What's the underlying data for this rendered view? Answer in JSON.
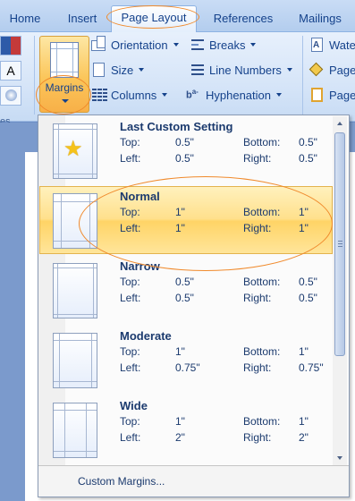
{
  "tabs": [
    "Home",
    "Insert",
    "Page Layout",
    "References",
    "Mailings"
  ],
  "active_tab": "Page Layout",
  "ribbon": {
    "margins_label": "Margins",
    "orientation_label": "Orientation",
    "size_label": "Size",
    "columns_label": "Columns",
    "breaks_label": "Breaks",
    "line_numbers_label": "Line Numbers",
    "hyphenation_label": "Hyphenation",
    "watermark_label": "Wate",
    "page_color_label": "Page",
    "page_borders_label": "Page",
    "left_group_label": "es",
    "font_button_label": "A"
  },
  "menu": {
    "items": [
      {
        "title": "Last Custom Setting",
        "top": "0.5\"",
        "bottom": "0.5\"",
        "left": "0.5\"",
        "right": "0.5\"",
        "icon": "star-icon"
      },
      {
        "title": "Normal",
        "top": "1\"",
        "bottom": "1\"",
        "left": "1\"",
        "right": "1\"",
        "highlighted": true
      },
      {
        "title": "Narrow",
        "top": "0.5\"",
        "bottom": "0.5\"",
        "left": "0.5\"",
        "right": "0.5\""
      },
      {
        "title": "Moderate",
        "top": "1\"",
        "bottom": "1\"",
        "left": "0.75\"",
        "right": "0.75\""
      },
      {
        "title": "Wide",
        "top": "1\"",
        "bottom": "1\"",
        "left": "2\"",
        "right": "2\""
      }
    ],
    "labels": {
      "top": "Top:",
      "bottom": "Bottom:",
      "left": "Left:",
      "right": "Right:"
    },
    "footer": "Custom Margins..."
  },
  "colors": {
    "highlight": "#ffe08c",
    "annotation": "#f08a2c",
    "ribbon_text": "#15428b"
  }
}
